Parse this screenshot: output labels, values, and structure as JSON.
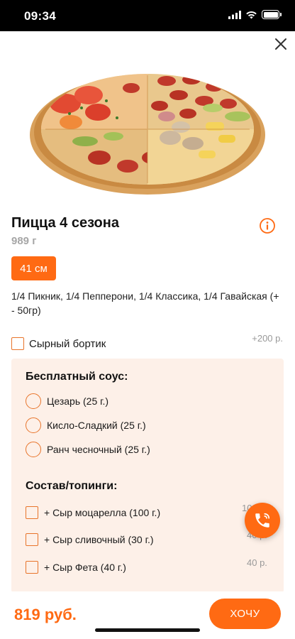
{
  "status_bar": {
    "time": "09:34"
  },
  "product": {
    "title": "Пицца 4 сезона",
    "weight": "989 г",
    "size": "41 см",
    "description": "1/4 Пикник, 1/4 Пепперони, 1/4 Классика, 1/4 Гавайская (+ - 50гр)"
  },
  "crust": {
    "label": "Сырный бортик",
    "price": "+200 р."
  },
  "sauce": {
    "title": "Бесплатный соус:",
    "options": [
      {
        "label": "Цезарь (25 г.)"
      },
      {
        "label": "Кисло-Сладкий (25 г.)"
      },
      {
        "label": "Ранч чесночный (25 г.)"
      }
    ]
  },
  "toppings": {
    "title": "Состав/топинги:",
    "items": [
      {
        "label": "+ Сыр моцарелла (100 г.)",
        "price": "100 р."
      },
      {
        "label": "+ Сыр сливочный (30 г.)",
        "price": "40 р."
      },
      {
        "label": "+ Сыр Фета (40 г.)",
        "price": "40 р."
      }
    ]
  },
  "footer": {
    "total": "819 руб.",
    "order_label": "ХОЧУ"
  },
  "icons": {
    "close": "close-icon",
    "info": "info-icon",
    "phone": "phone-icon",
    "wifi": "wifi-icon",
    "signal": "signal-icon",
    "battery": "battery-icon"
  },
  "colors": {
    "accent": "#ff6a13",
    "panel": "#fdf0e8",
    "muted": "#a6a6a6"
  }
}
